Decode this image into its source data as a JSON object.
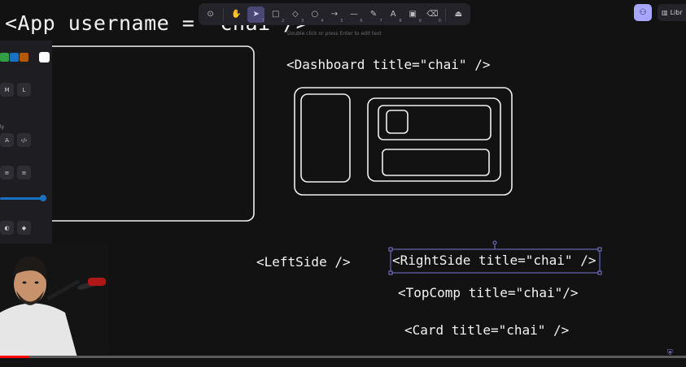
{
  "toolbar": {
    "tools": [
      {
        "icon": "lock-icon",
        "glyph": "⊙",
        "num": ""
      },
      {
        "icon": "hand-icon",
        "glyph": "✋",
        "num": ""
      },
      {
        "icon": "selection-icon",
        "glyph": "➤",
        "num": "1"
      },
      {
        "icon": "rectangle-icon",
        "glyph": "□",
        "num": "2"
      },
      {
        "icon": "diamond-icon",
        "glyph": "◇",
        "num": "3"
      },
      {
        "icon": "ellipse-icon",
        "glyph": "○",
        "num": "4"
      },
      {
        "icon": "arrow-icon",
        "glyph": "→",
        "num": "5"
      },
      {
        "icon": "line-icon",
        "glyph": "—",
        "num": "6"
      },
      {
        "icon": "pencil-icon",
        "glyph": "✎",
        "num": "7"
      },
      {
        "icon": "text-icon",
        "glyph": "A",
        "num": "8"
      },
      {
        "icon": "image-icon",
        "glyph": "▣",
        "num": "9"
      },
      {
        "icon": "eraser-icon",
        "glyph": "⌫",
        "num": "0"
      },
      {
        "icon": "extra-tools-icon",
        "glyph": "⏏",
        "num": ""
      }
    ],
    "active_index": 2
  },
  "hint_text": "Double click or press Enter to edit text",
  "header_text": "<App username = \"chai\"/>",
  "library_label": "Libr",
  "left_panel": {
    "swatches": [
      "#2f9e44",
      "#1971c2",
      "#b35a00"
    ],
    "selected_swatch": "#ffffff",
    "size_options": [
      "M",
      "L"
    ],
    "font_label": "ly",
    "font_options": [
      "A",
      "‹/›"
    ],
    "align_options": [
      "≡",
      "≡"
    ],
    "opacity": 1.0,
    "layer_icons": [
      "◐",
      "◆"
    ]
  },
  "canvas": {
    "dashboard_label": "<Dashboard title=\"chai\" />",
    "leftside_label": "<LeftSide />",
    "rightside_label": "<RightSide title=\"chai\" />",
    "topcomp_label": "<TopComp  title=\"chai\"/>",
    "card_label": "<Card title=\"chai\" />"
  },
  "video": {
    "progress": 0.043
  }
}
